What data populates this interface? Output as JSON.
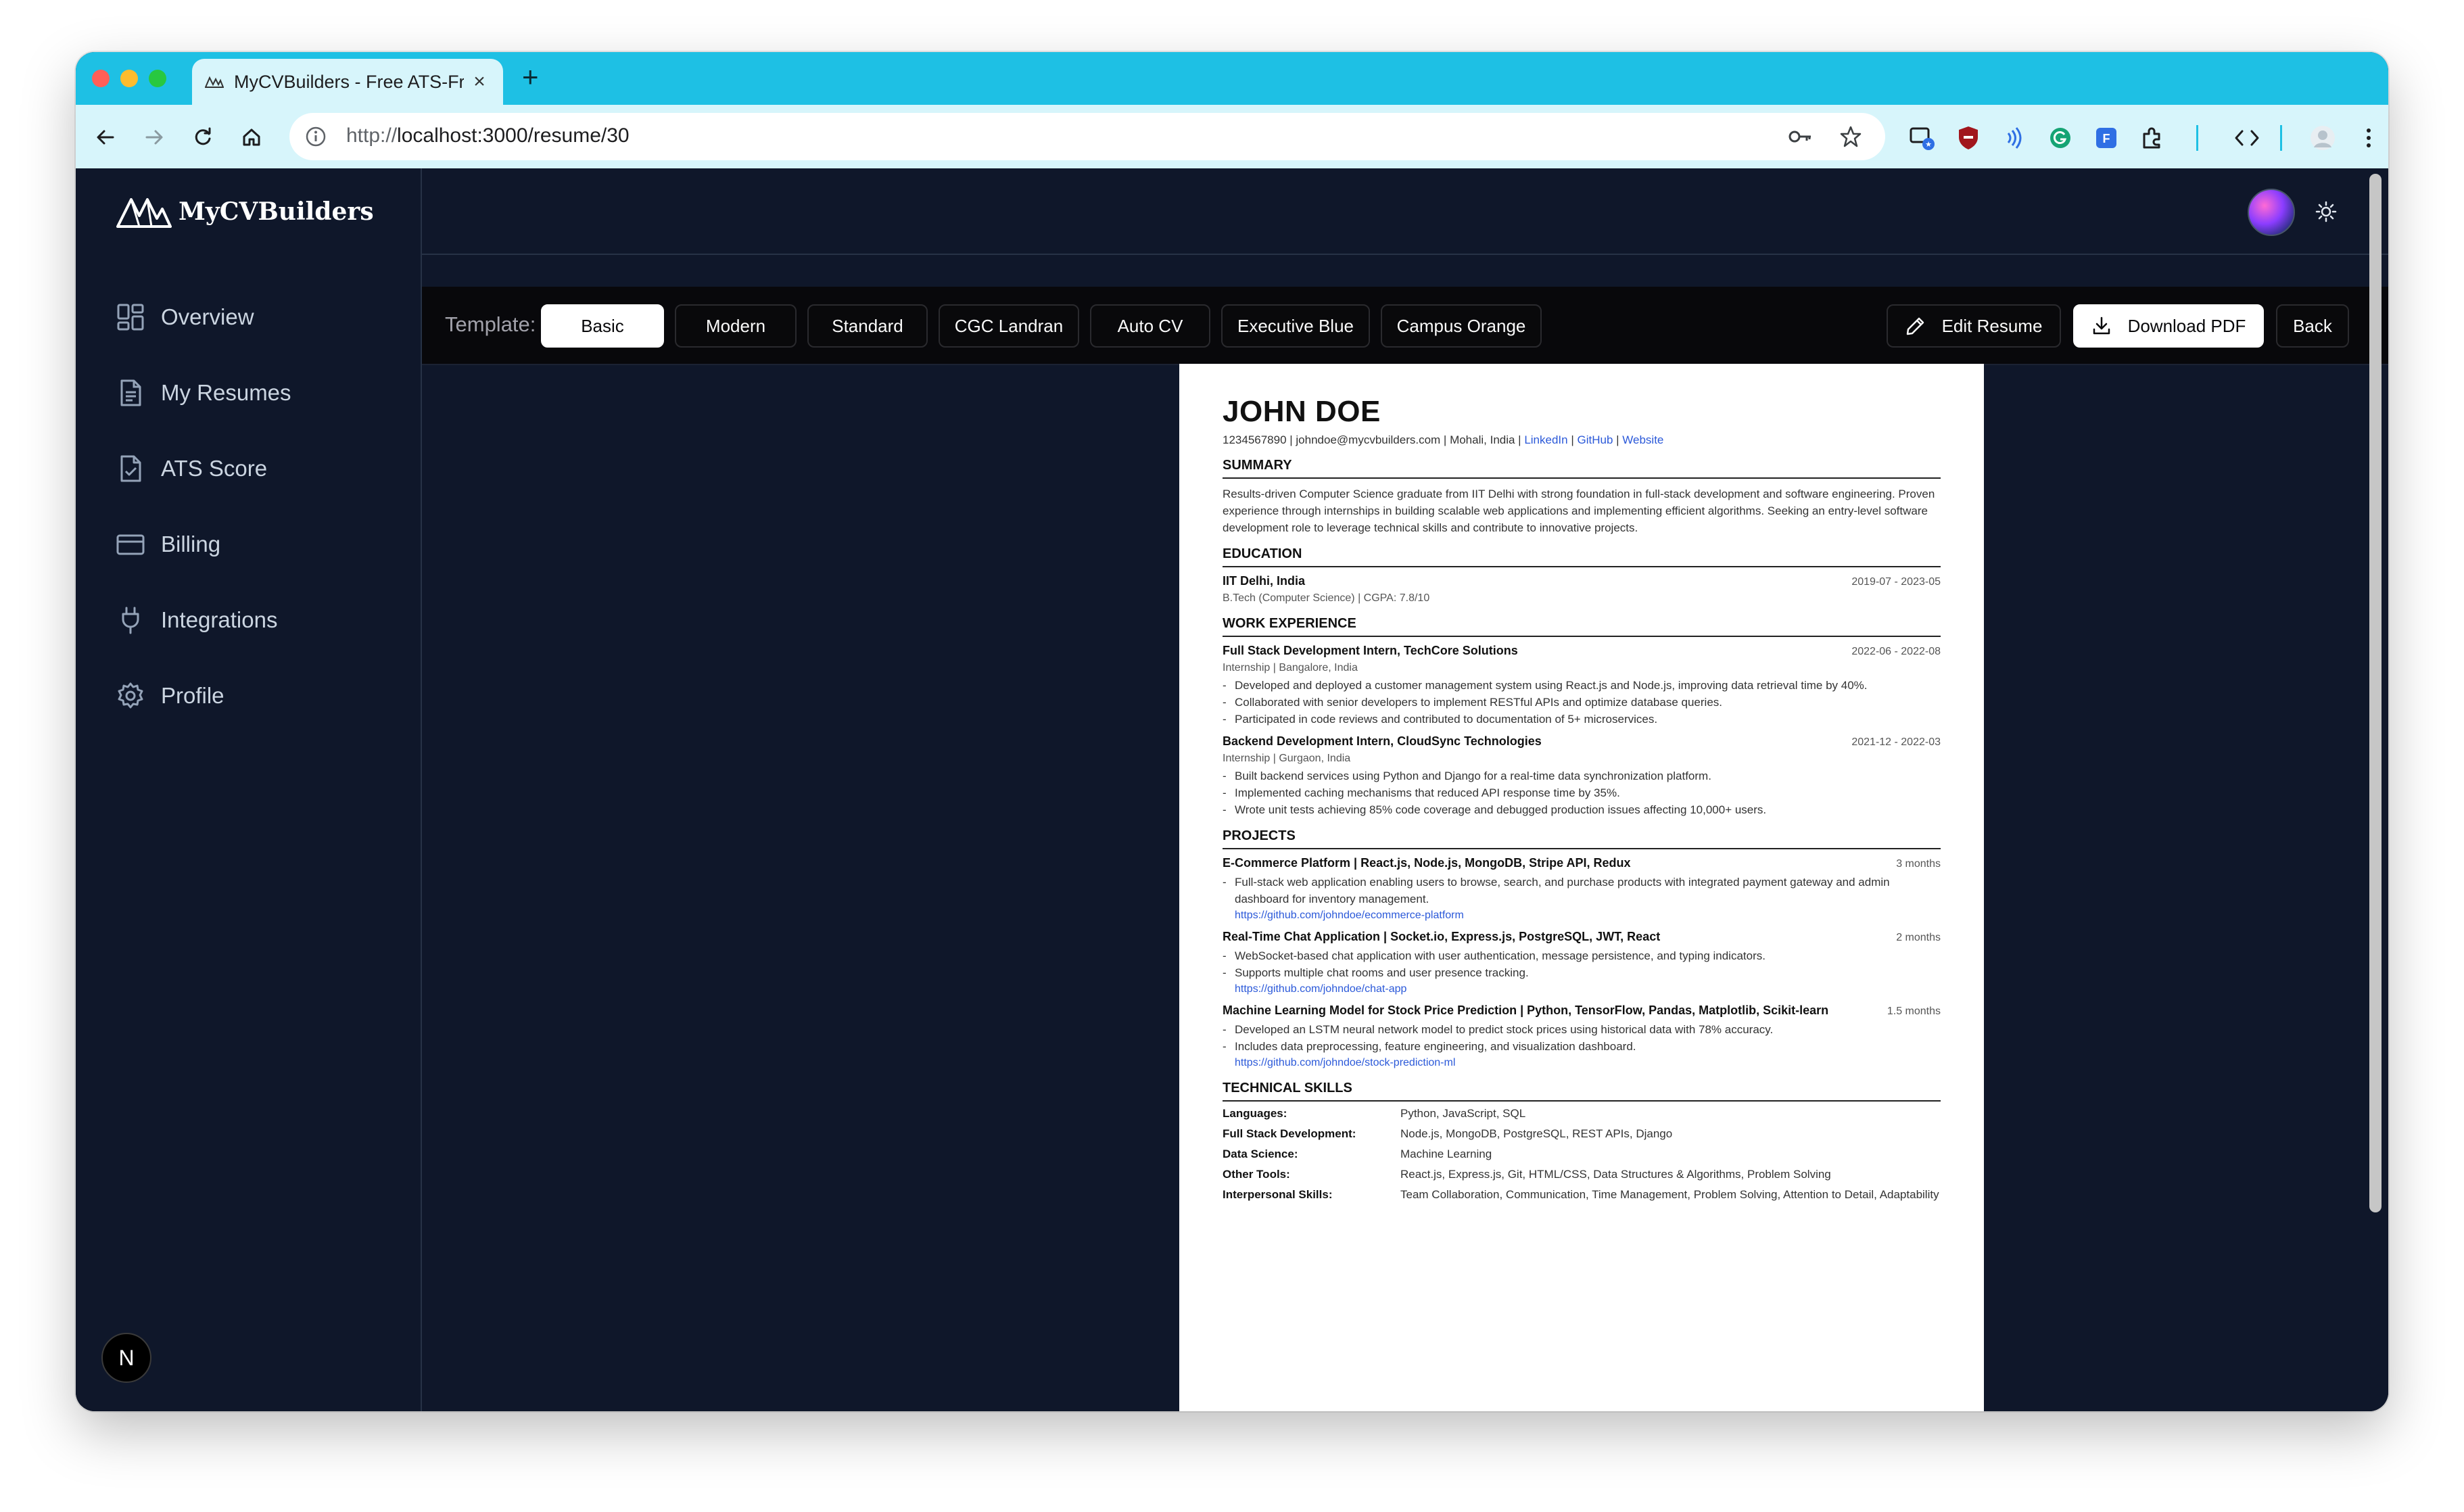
{
  "browser": {
    "tab_title": "MyCVBuilders - Free ATS-Frie",
    "url_scheme": "http://",
    "url_host": "localhost",
    "url_rest": ":3000/resume/30",
    "traffic_colors": [
      "#ff5f57",
      "#febc2e",
      "#28c840"
    ]
  },
  "app": {
    "brand": "MyCVBuilders",
    "nav": [
      {
        "label": "Overview",
        "icon": "layout-dashboard-icon"
      },
      {
        "label": "My Resumes",
        "icon": "file-text-icon"
      },
      {
        "label": "ATS Score",
        "icon": "file-check-icon"
      },
      {
        "label": "Billing",
        "icon": "credit-card-icon"
      },
      {
        "label": "Integrations",
        "icon": "plug-icon"
      },
      {
        "label": "Profile",
        "icon": "gear-icon"
      }
    ],
    "next_badge": "N"
  },
  "toolbar": {
    "template_label": "Template:",
    "templates": [
      "Basic",
      "Modern",
      "Standard",
      "CGC Landran",
      "Auto CV",
      "Executive Blue",
      "Campus Orange"
    ],
    "active_template": "Basic",
    "edit_label": "Edit Resume",
    "download_label": "Download PDF",
    "back_label": "Back"
  },
  "resume": {
    "name": "JOHN DOE",
    "contact": "1234567890 | johndoe@mycvbuilders.com | Mohali, India |",
    "links": [
      "LinkedIn",
      "GitHub",
      "Website"
    ],
    "sections": {
      "summary": "SUMMARY",
      "education": "EDUCATION",
      "work": "WORK EXPERIENCE",
      "projects": "PROJECTS",
      "skills": "TECHNICAL SKILLS"
    },
    "summary": "Results-driven Computer Science graduate from IIT Delhi with strong foundation in full-stack development and software engineering. Proven experience through internships in building scalable web applications and implementing efficient algorithms. Seeking an entry-level software development role to leverage technical skills and contribute to innovative projects.",
    "education": {
      "school": "IIT Delhi, India",
      "dates": "2019-07 - 2023-05",
      "degree": "B.Tech (Computer Science) | CGPA: 7.8/10"
    },
    "work": [
      {
        "title": "Full Stack Development Intern, TechCore Solutions",
        "dates": "2022-06 - 2022-08",
        "sub": "Internship | Bangalore, India",
        "bullets": [
          "Developed and deployed a customer management system using React.js and Node.js, improving data retrieval time by 40%.",
          "Collaborated with senior developers to implement RESTful APIs and optimize database queries.",
          "Participated in code reviews and contributed to documentation of 5+ microservices."
        ]
      },
      {
        "title": "Backend Development Intern, CloudSync Technologies",
        "dates": "2021-12 - 2022-03",
        "sub": "Internship | Gurgaon, India",
        "bullets": [
          "Built backend services using Python and Django for a real-time data synchronization platform.",
          "Implemented caching mechanisms that reduced API response time by 35%.",
          "Wrote unit tests achieving 85% code coverage and debugged production issues affecting 10,000+ users."
        ]
      }
    ],
    "projects": [
      {
        "title": "E-Commerce Platform | React.js, Node.js, MongoDB, Stripe API, Redux",
        "duration": "3 months",
        "bullets": [
          "Full-stack web application enabling users to browse, search, and purchase products with integrated payment gateway and admin dashboard for inventory management."
        ],
        "url": "https://github.com/johndoe/ecommerce-platform"
      },
      {
        "title": "Real-Time Chat Application | Socket.io, Express.js, PostgreSQL, JWT, React",
        "duration": "2 months",
        "bullets": [
          "WebSocket-based chat application with user authentication, message persistence, and typing indicators.",
          "Supports multiple chat rooms and user presence tracking."
        ],
        "url": "https://github.com/johndoe/chat-app"
      },
      {
        "title": "Machine Learning Model for Stock Price Prediction | Python, TensorFlow, Pandas, Matplotlib, Scikit-learn",
        "duration": "1.5 months",
        "bullets": [
          "Developed an LSTM neural network model to predict stock prices using historical data with 78% accuracy.",
          "Includes data preprocessing, feature engineering, and visualization dashboard."
        ],
        "url": "https://github.com/johndoe/stock-prediction-ml"
      }
    ],
    "skills": [
      {
        "key": "Languages:",
        "value": "Python, JavaScript, SQL"
      },
      {
        "key": "Full Stack Development:",
        "value": "Node.js, MongoDB, PostgreSQL, REST APIs, Django"
      },
      {
        "key": "Data Science:",
        "value": "Machine Learning"
      },
      {
        "key": "Other Tools:",
        "value": "React.js, Express.js, Git, HTML/CSS, Data Structures & Algorithms, Problem Solving"
      },
      {
        "key": "Interpersonal Skills:",
        "value": "Team Collaboration, Communication, Time Management, Problem Solving, Attention to Detail, Adaptability"
      }
    ]
  }
}
